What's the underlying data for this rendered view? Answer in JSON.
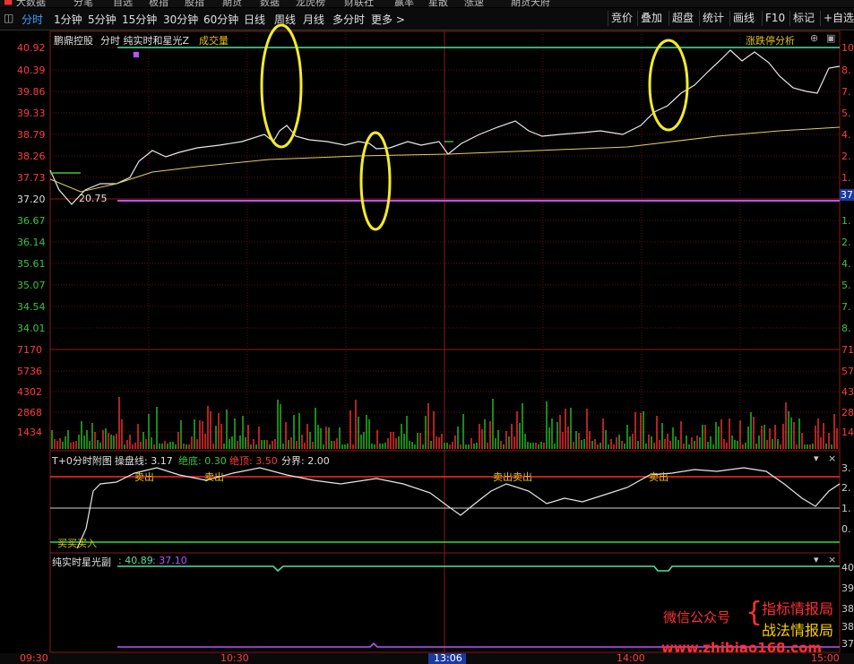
{
  "menu": [
    "大数据",
    "分笔",
    "自选",
    "板指",
    "股指",
    "期货",
    "数据",
    "龙虎榜",
    "财联社",
    "赢率",
    "星散",
    "涨速",
    "期货天府"
  ],
  "tabs": [
    "分时",
    "1分钟",
    "5分钟",
    "15分钟",
    "30分钟",
    "60分钟",
    "日线",
    "周线",
    "月线",
    "多分时",
    "更多 >"
  ],
  "right_buttons": [
    "竞价",
    "叠加",
    "超盘",
    "统计",
    "画线",
    "F10",
    "标记",
    "+自选"
  ],
  "main": {
    "stock_name": "鹏鼎控股",
    "title_label": "分时 纯实时和星光Z",
    "volume_label": "成交量",
    "limit_label": "涨跌停分析",
    "price_ticks": [
      "40.92",
      "40.39",
      "39.86",
      "39.33",
      "38.79",
      "38.26",
      "37.73",
      "37.20",
      "36.67",
      "36.14",
      "35.61",
      "35.07",
      "34.54",
      "34.01"
    ],
    "right_ticks": [
      "10",
      "8.",
      "7.",
      "5.",
      "4.",
      "2.",
      "1.",
      "37",
      "1.",
      "2.",
      "4.",
      "5.",
      "7.",
      "8."
    ],
    "low_label": "20.75",
    "volume_ticks": [
      "7170",
      "5736",
      "4302",
      "2868",
      "1434"
    ],
    "volume_right_ticks": [
      "71",
      "57",
      "43",
      "28",
      "14"
    ]
  },
  "sub1": {
    "title": "T+0分时附图",
    "line1_label": "操盘线: 3.17",
    "line2_label": "绝底: 0.30",
    "line3_label": "绝顶: 3.50",
    "line4_label": "分界: 2.00",
    "sell_labels": [
      "卖出",
      "卖出",
      "卖出卖出",
      "卖出"
    ],
    "buy_label": "买买买入",
    "right_ticks": [
      "3.",
      "2.",
      "1.",
      "0."
    ]
  },
  "sub2": {
    "title": "纯实时星光副",
    "value1": ": 40.89",
    "value2": ": 37.10",
    "right_ticks": [
      "40",
      "39",
      "38",
      "38",
      "37"
    ]
  },
  "time_axis": [
    "09:30",
    "10:30",
    "13:06",
    "14:00",
    "15:00"
  ],
  "watermark": {
    "left": "微信公众号",
    "line1": "指标情报局",
    "line2": "战法情报局",
    "url": "www.zhibiao168.com"
  },
  "colors": {
    "red": "#ff3c3c",
    "green": "#3cc43c",
    "accent": "#3aa0ff",
    "yellow": "#f2ec2a",
    "mint": "#4fe0a0",
    "purple": "#c050ff"
  }
}
